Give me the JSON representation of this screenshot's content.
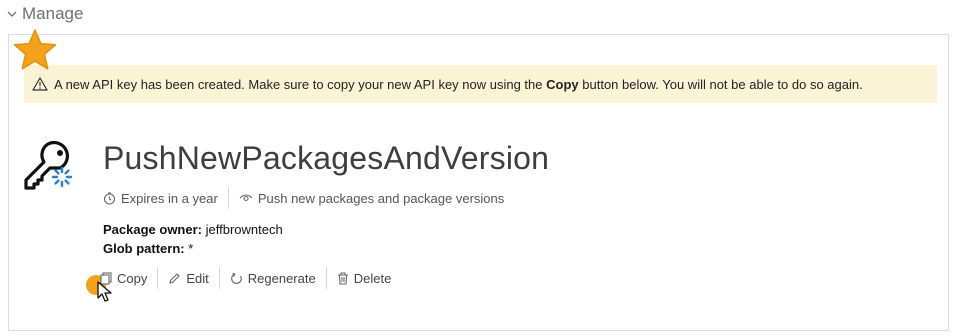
{
  "section": {
    "title": "Manage"
  },
  "alert": {
    "prefix": "A new API key has been created. Make sure to copy your new API key now using the",
    "bold": "Copy",
    "suffix": "button below. You will not be able to do so again."
  },
  "api_key": {
    "name": "PushNewPackagesAndVersion",
    "expires": "Expires in a year",
    "scope": "Push new packages and package versions",
    "owner_label": "Package owner:",
    "owner_value": "jeffbrowntech",
    "glob_label": "Glob pattern:",
    "glob_value": "*"
  },
  "actions": {
    "copy": "Copy",
    "edit": "Edit",
    "regenerate": "Regenerate",
    "delete": "Delete"
  },
  "colors": {
    "alert_bg": "#fbf3d6",
    "star": "#f2a31b",
    "spinner": "#2d7fd3"
  },
  "icons": [
    "chevron-down-icon",
    "star-icon",
    "warning-icon",
    "key-icon",
    "spinner-icon",
    "clock-icon",
    "eye-icon",
    "copy-icon",
    "pencil-icon",
    "refresh-icon",
    "trash-icon",
    "cursor-icon"
  ]
}
